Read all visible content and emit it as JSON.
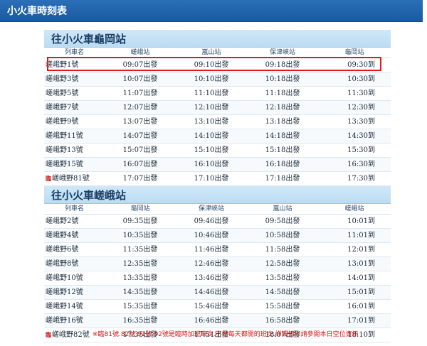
{
  "header": {
    "title": "小火車時刻表"
  },
  "kameoka": {
    "title": "往小火車龜岡站",
    "columns": [
      "列車名",
      "嵯峨站",
      "嵐山站",
      "保津峽站",
      "龜岡站"
    ],
    "rows": [
      {
        "badge": "",
        "name": "嵯峨野1號",
        "s1": "09:07出發",
        "s2": "09:10出發",
        "s3": "09:18出發",
        "s4": "09:30到"
      },
      {
        "badge": "",
        "name": "嵯峨野3號",
        "s1": "10:07出發",
        "s2": "10:10出發",
        "s3": "10:18出發",
        "s4": "10:30到"
      },
      {
        "badge": "",
        "name": "嵯峨野5號",
        "s1": "11:07出發",
        "s2": "11:10出發",
        "s3": "11:18出發",
        "s4": "11:30到"
      },
      {
        "badge": "",
        "name": "嵯峨野7號",
        "s1": "12:07出發",
        "s2": "12:10出發",
        "s3": "12:18出發",
        "s4": "12:30到"
      },
      {
        "badge": "",
        "name": "嵯峨野9號",
        "s1": "13:07出發",
        "s2": "13:10出發",
        "s3": "13:18出發",
        "s4": "13:30到"
      },
      {
        "badge": "",
        "name": "嵯峨野11號",
        "s1": "14:07出發",
        "s2": "14:10出發",
        "s3": "14:18出發",
        "s4": "14:30到"
      },
      {
        "badge": "",
        "name": "嵯峨野13號",
        "s1": "15:07出發",
        "s2": "15:10出發",
        "s3": "15:18出發",
        "s4": "15:30到"
      },
      {
        "badge": "",
        "name": "嵯峨野15號",
        "s1": "16:07出發",
        "s2": "16:10出發",
        "s3": "16:18出發",
        "s4": "16:30到"
      },
      {
        "badge": "臨",
        "name": "嵯峨野81號",
        "s1": "17:07出發",
        "s2": "17:10出發",
        "s3": "17:18出發",
        "s4": "17:30到"
      }
    ]
  },
  "saga": {
    "title": "往小火車嵯峨站",
    "columns": [
      "列車名",
      "龜岡站",
      "保津峽站",
      "嵐山站",
      "嵯峨站"
    ],
    "rows": [
      {
        "badge": "",
        "name": "嵯峨野2號",
        "s1": "09:35出發",
        "s2": "09:46出發",
        "s3": "09:58出發",
        "s4": "10:01到"
      },
      {
        "badge": "",
        "name": "嵯峨野4號",
        "s1": "10:35出發",
        "s2": "10:46出發",
        "s3": "10:58出發",
        "s4": "11:01到"
      },
      {
        "badge": "",
        "name": "嵯峨野6號",
        "s1": "11:35出發",
        "s2": "11:46出發",
        "s3": "11:58出發",
        "s4": "12:01到"
      },
      {
        "badge": "",
        "name": "嵯峨野8號",
        "s1": "12:35出發",
        "s2": "12:46出發",
        "s3": "12:58出發",
        "s4": "13:01到"
      },
      {
        "badge": "",
        "name": "嵯峨野10號",
        "s1": "13:35出發",
        "s2": "13:46出發",
        "s3": "13:58出發",
        "s4": "14:01到"
      },
      {
        "badge": "",
        "name": "嵯峨野12號",
        "s1": "14:35出發",
        "s2": "14:46出發",
        "s3": "14:58出發",
        "s4": "15:01到"
      },
      {
        "badge": "",
        "name": "嵯峨野14號",
        "s1": "15:35出發",
        "s2": "15:46出發",
        "s3": "15:58出發",
        "s4": "16:01到"
      },
      {
        "badge": "",
        "name": "嵯峨野16號",
        "s1": "16:35出發",
        "s2": "16:46出發",
        "s3": "16:58出發",
        "s4": "17:01到"
      },
      {
        "badge": "臨",
        "name": "嵯峨野82號",
        "s1": "17:35出發",
        "s2": "17:51出發",
        "s3": "18:07出發",
        "s4": "18:10到"
      }
    ]
  },
  "note": "※臨81號.82號.91號.92號是臨時加班車次.不是每天都開的班次.詳細情形請參閱本日空位資訊",
  "colors": {
    "header": "#1a5aa0",
    "section": "#bcdcf2",
    "highlight": "#e01a1a",
    "note": "#d01818"
  }
}
